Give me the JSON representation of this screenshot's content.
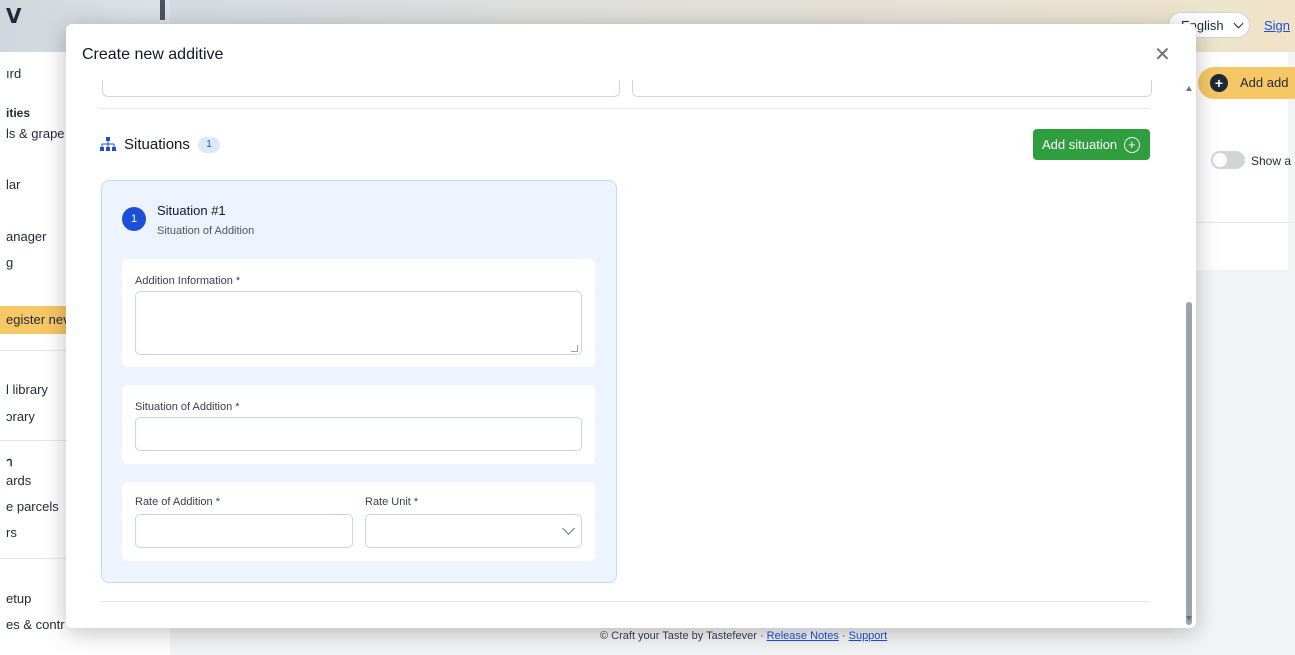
{
  "background": {
    "sidebar": {
      "logo": "V",
      "items": [
        {
          "label": "ırd"
        },
        {
          "label": "ities"
        },
        {
          "label": "ls & grape"
        },
        {
          "label": "lar"
        },
        {
          "label": "anager"
        },
        {
          "label": "g"
        },
        {
          "label": "egister nev"
        },
        {
          "label": "l library"
        },
        {
          "label": "ɔrary"
        },
        {
          "label": "า"
        },
        {
          "label": "ards"
        },
        {
          "label": "e parcels"
        },
        {
          "label": "rs"
        },
        {
          "label": "etup"
        },
        {
          "label": "es & contr"
        }
      ]
    },
    "header": {
      "language": "English",
      "sign_link": "Sign"
    },
    "add_additive_button": "Add add",
    "show_toggle_label": "Show a",
    "footer": {
      "copyright": "© Craft your Taste by Tastefever",
      "separator": " · ",
      "release_notes": "Release Notes",
      "support": "Support"
    }
  },
  "modal": {
    "title": "Create new additive",
    "close_icon": "close-icon",
    "situations": {
      "title": "Situations",
      "count": "1",
      "add_button": "Add situation",
      "items": [
        {
          "number": "1",
          "title": "Situation #1",
          "subtitle": "Situation of Addition",
          "addition_information_label": "Addition Information *",
          "addition_information_value": "",
          "situation_of_addition_label": "Situation of Addition *",
          "situation_of_addition_value": "",
          "rate_of_addition_label": "Rate of Addition *",
          "rate_of_addition_value": "",
          "rate_unit_label": "Rate Unit *",
          "rate_unit_value": ""
        }
      ]
    }
  },
  "colors": {
    "primary_blue": "#1d4ed8",
    "add_button_green": "#2e9e3e",
    "accent_yellow": "#f6c765"
  }
}
